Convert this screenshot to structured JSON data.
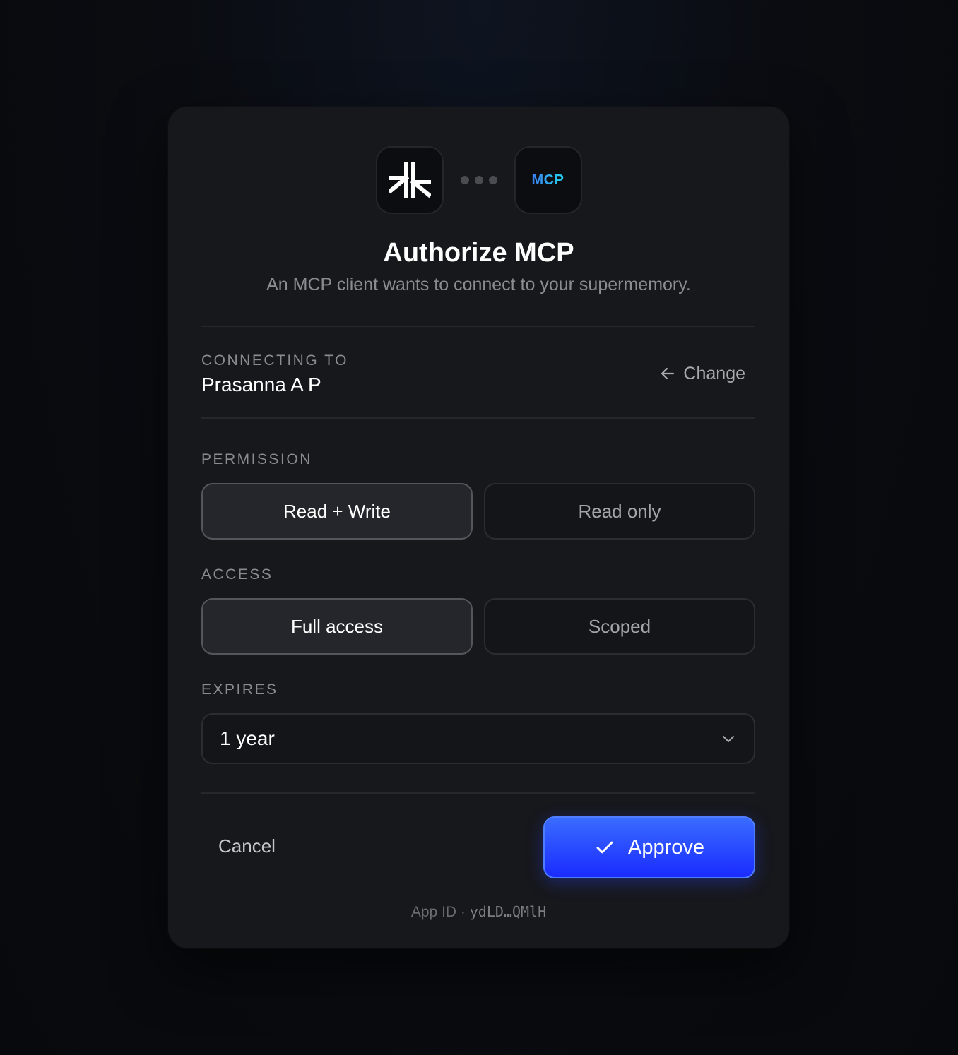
{
  "header": {
    "client_logo_text": "MCP",
    "title": "Authorize MCP",
    "subtitle": "An MCP client wants to connect to your supermemory."
  },
  "account": {
    "label": "CONNECTING TO",
    "name": "Prasanna A P",
    "change_label": "Change"
  },
  "permission": {
    "label": "PERMISSION",
    "options": [
      {
        "label": "Read + Write",
        "selected": true
      },
      {
        "label": "Read only",
        "selected": false
      }
    ]
  },
  "access": {
    "label": "ACCESS",
    "options": [
      {
        "label": "Full access",
        "selected": true
      },
      {
        "label": "Scoped",
        "selected": false
      }
    ]
  },
  "expires": {
    "label": "EXPIRES",
    "value": "1 year"
  },
  "actions": {
    "cancel_label": "Cancel",
    "approve_label": "Approve"
  },
  "footer": {
    "app_id_prefix": "App ID · ",
    "app_id_value": "ydLD…QMlH"
  },
  "colors": {
    "accent": "#1a2bff",
    "card_bg": "#17181c"
  }
}
